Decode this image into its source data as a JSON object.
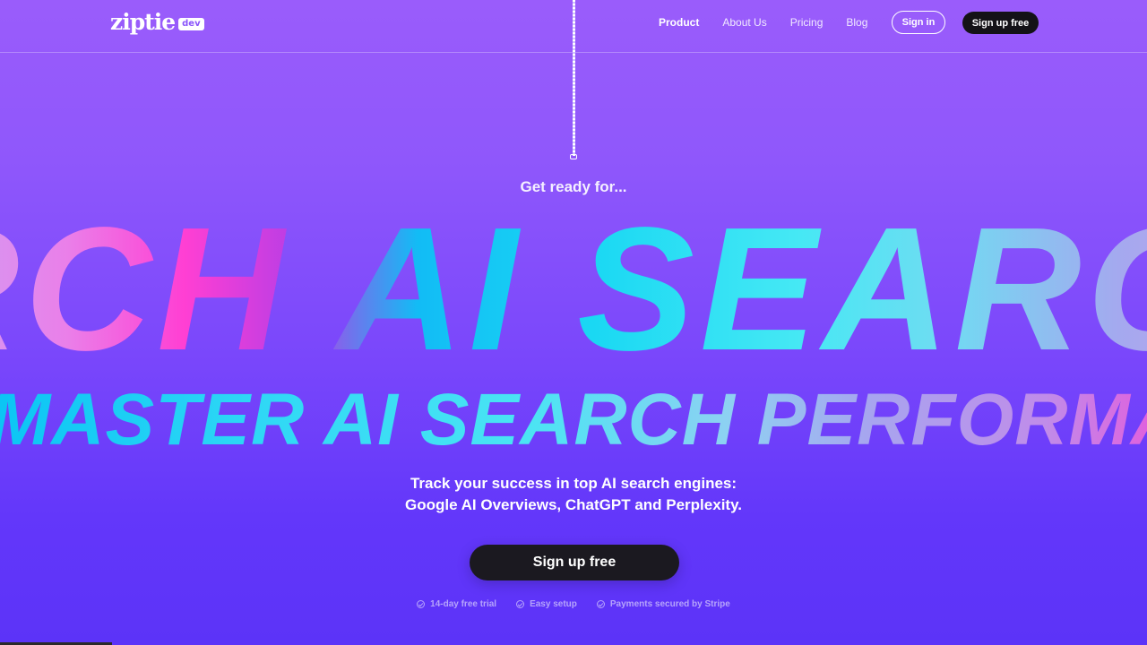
{
  "header": {
    "logo_text": "ziptie",
    "logo_badge": "dev",
    "nav": [
      {
        "label": "Product"
      },
      {
        "label": "About Us"
      },
      {
        "label": "Pricing"
      },
      {
        "label": "Blog"
      }
    ],
    "signin_label": "Sign in",
    "signup_label": "Sign up free"
  },
  "hero": {
    "eyebrow": "Get ready for...",
    "marquee_line1": "RCH AI SEARCH",
    "marquee_line2": "MASTER AI SEARCH PERFORMANCE",
    "subtitle_line1": "Track your success in top AI search engines:",
    "subtitle_line2": "Google AI Overviews, ChatGPT and Perplexity.",
    "cta_label": "Sign up free",
    "features": [
      {
        "label": "14-day free trial",
        "icon": "check-circle-icon"
      },
      {
        "label": "Easy setup",
        "icon": "check-circle-icon"
      },
      {
        "label": "Payments secured by Stripe",
        "icon": "check-circle-icon"
      }
    ]
  },
  "colors": {
    "background_top": "#9a5cfb",
    "background_bottom": "#5c33f8",
    "button_dark": "#141217",
    "accent_pink": "#ff3fd3",
    "accent_cyan": "#12bcf5"
  }
}
